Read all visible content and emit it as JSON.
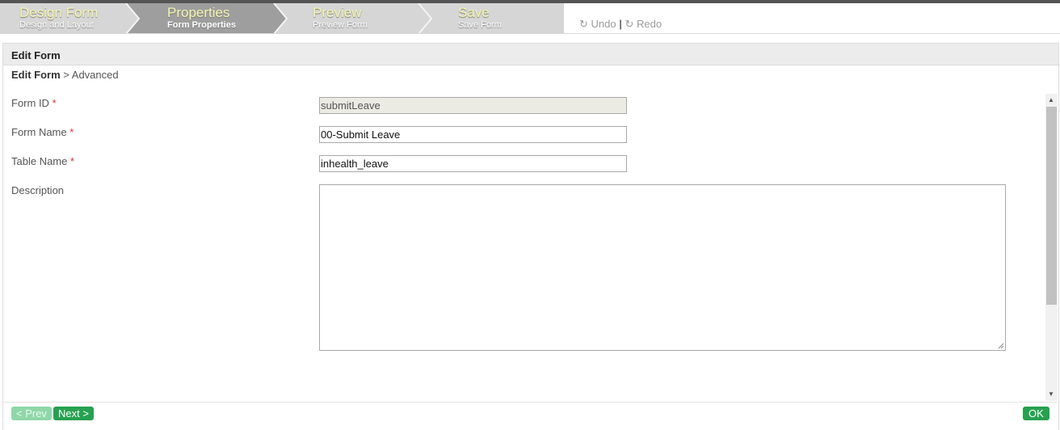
{
  "wizard": {
    "steps": [
      {
        "title": "Design Form",
        "subtitle": "Design and Layout"
      },
      {
        "title": "Properties",
        "subtitle": "Form Properties"
      },
      {
        "title": "Preview",
        "subtitle": "Preview Form"
      },
      {
        "title": "Save",
        "subtitle": "Save Form"
      }
    ],
    "active_step": "Properties",
    "undo_label": "Undo",
    "redo_label": "Redo",
    "separator": "|"
  },
  "panel": {
    "title": "Edit Form",
    "breadcrumb": {
      "root": "Edit Form",
      "sep": " > ",
      "current": "Advanced"
    }
  },
  "form": {
    "required_mark": "*",
    "fields": {
      "form_id": {
        "label": "Form ID",
        "value": "submitLeave"
      },
      "form_name": {
        "label": "Form Name",
        "value": "00-Submit Leave"
      },
      "table_name": {
        "label": "Table Name",
        "value": "inhealth_leave"
      },
      "description": {
        "label": "Description",
        "value": ""
      }
    }
  },
  "footer": {
    "prev_label": "< Prev",
    "next_label": "Next >",
    "ok_label": "OK"
  },
  "colors": {
    "accent_green": "#27a150",
    "disabled_green": "#8fd7a8",
    "step_title": "#f6f6b0",
    "required": "#e03030"
  }
}
